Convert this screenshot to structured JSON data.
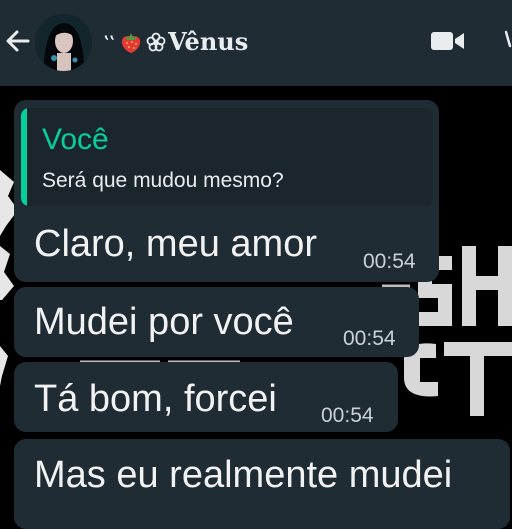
{
  "header": {
    "contact_name_prefix": "‛‛",
    "contact_name": "Vênus",
    "icons": {
      "back": "arrow-left-icon",
      "avatar": "avatar",
      "strawberry": "strawberry-icon",
      "flower": "flower-icon",
      "video": "video-camera-icon"
    },
    "colors": {
      "background": "#1f2c34",
      "text": "#e9edef"
    }
  },
  "messages": [
    {
      "reply": {
        "author": "Você",
        "text": "Será que mudou mesmo?"
      },
      "text": "Claro, meu amor",
      "time": "00:54"
    },
    {
      "text": "Mudei por você",
      "time": "00:54"
    },
    {
      "text": "Tá bom, forcei",
      "time": "00:54"
    },
    {
      "text": "Mas eu realmente mudei",
      "time": ""
    }
  ],
  "colors": {
    "bubble": "#1f2c34",
    "quote_accent": "#06cf9c",
    "wallpaper": "#000000"
  }
}
